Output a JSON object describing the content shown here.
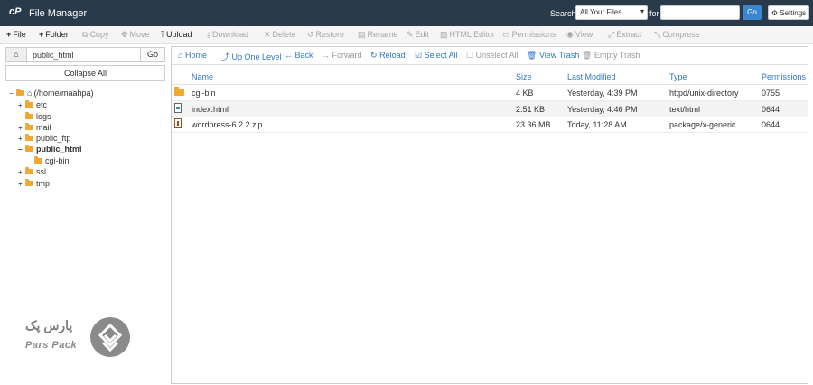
{
  "topbar": {
    "logo": "cP",
    "title": "File Manager",
    "search_label": "Search",
    "search_scope": "All Your Files",
    "for_label": "for",
    "search_value": "",
    "go_label": "Go",
    "settings_label": "Settings"
  },
  "toolbar": {
    "items": [
      {
        "label": "File",
        "icon": "+",
        "enabled": true
      },
      {
        "label": "Folder",
        "icon": "+",
        "enabled": true
      },
      {
        "label": "Copy",
        "icon": "⧉",
        "enabled": false
      },
      {
        "label": "Move",
        "icon": "✥",
        "enabled": false
      },
      {
        "label": "Upload",
        "icon": "⤒",
        "enabled": true
      },
      {
        "label": "Download",
        "icon": "⤓",
        "enabled": false
      },
      {
        "label": "Delete",
        "icon": "✕",
        "enabled": false
      },
      {
        "label": "Restore",
        "icon": "↺",
        "enabled": false
      },
      {
        "label": "Rename",
        "icon": "▤",
        "enabled": false
      },
      {
        "label": "Edit",
        "icon": "✎",
        "enabled": false
      },
      {
        "label": "HTML Editor",
        "icon": "▧",
        "enabled": false
      },
      {
        "label": "Permissions",
        "icon": "▭",
        "enabled": false
      },
      {
        "label": "View",
        "icon": "◉",
        "enabled": false
      },
      {
        "label": "Extract",
        "icon": "⤢",
        "enabled": false
      },
      {
        "label": "Compress",
        "icon": "⤡",
        "enabled": false
      }
    ]
  },
  "sidebar": {
    "path_value": "public_html",
    "go_label": "Go",
    "collapse_label": "Collapse All",
    "tree": [
      {
        "label": "(/home/maahpa)",
        "toggle": "−",
        "home": true,
        "bold": false
      },
      {
        "label": "etc",
        "toggle": "+",
        "bold": false
      },
      {
        "label": "logs",
        "toggle": "",
        "bold": false
      },
      {
        "label": "mail",
        "toggle": "+",
        "bold": false
      },
      {
        "label": "public_ftp",
        "toggle": "+",
        "bold": false
      },
      {
        "label": "public_html",
        "toggle": "−",
        "bold": true
      },
      {
        "label": "cgi-bin",
        "toggle": "",
        "bold": false
      },
      {
        "label": "ssl",
        "toggle": "+",
        "bold": false
      },
      {
        "label": "tmp",
        "toggle": "+",
        "bold": false
      }
    ]
  },
  "navbar": {
    "items": [
      {
        "label": "Home",
        "icon": "⌂",
        "enabled": true
      },
      {
        "label": "Up One Level",
        "icon": "⤴",
        "enabled": true
      },
      {
        "label": "Back",
        "icon": "←",
        "enabled": true
      },
      {
        "label": "Forward",
        "icon": "→",
        "enabled": false
      },
      {
        "label": "Reload",
        "icon": "↻",
        "enabled": true
      },
      {
        "label": "Select All",
        "icon": "☑",
        "enabled": true
      },
      {
        "label": "Unselect All",
        "icon": "☐",
        "enabled": false
      },
      {
        "label": "View Trash",
        "icon": "🗑",
        "enabled": true
      },
      {
        "label": "Empty Trash",
        "icon": "🗑",
        "enabled": false
      }
    ]
  },
  "table": {
    "headers": {
      "name": "Name",
      "size": "Size",
      "modified": "Last Modified",
      "type": "Type",
      "perms": "Permissions"
    },
    "rows": [
      {
        "icon": "folder-icon",
        "name": "cgi-bin",
        "size": "4 KB",
        "modified": "Yesterday, 4:39 PM",
        "type": "httpd/unix-directory",
        "perms": "0755"
      },
      {
        "icon": "html-file-icon",
        "name": "index.html",
        "size": "2.51 KB",
        "modified": "Yesterday, 4:46 PM",
        "type": "text/html",
        "perms": "0644"
      },
      {
        "icon": "zip-file-icon",
        "name": "wordpress-6.2.2.zip",
        "size": "23.36 MB",
        "modified": "Today, 11:28 AM",
        "type": "package/x-generic",
        "perms": "0644"
      }
    ]
  },
  "watermark": {
    "text_fa": "پارس پک",
    "text_en": "Pars Pack"
  },
  "colors": {
    "topbar_bg": "#293a4a",
    "accent_blue": "#2e78c4",
    "folder": "#f0a830"
  }
}
